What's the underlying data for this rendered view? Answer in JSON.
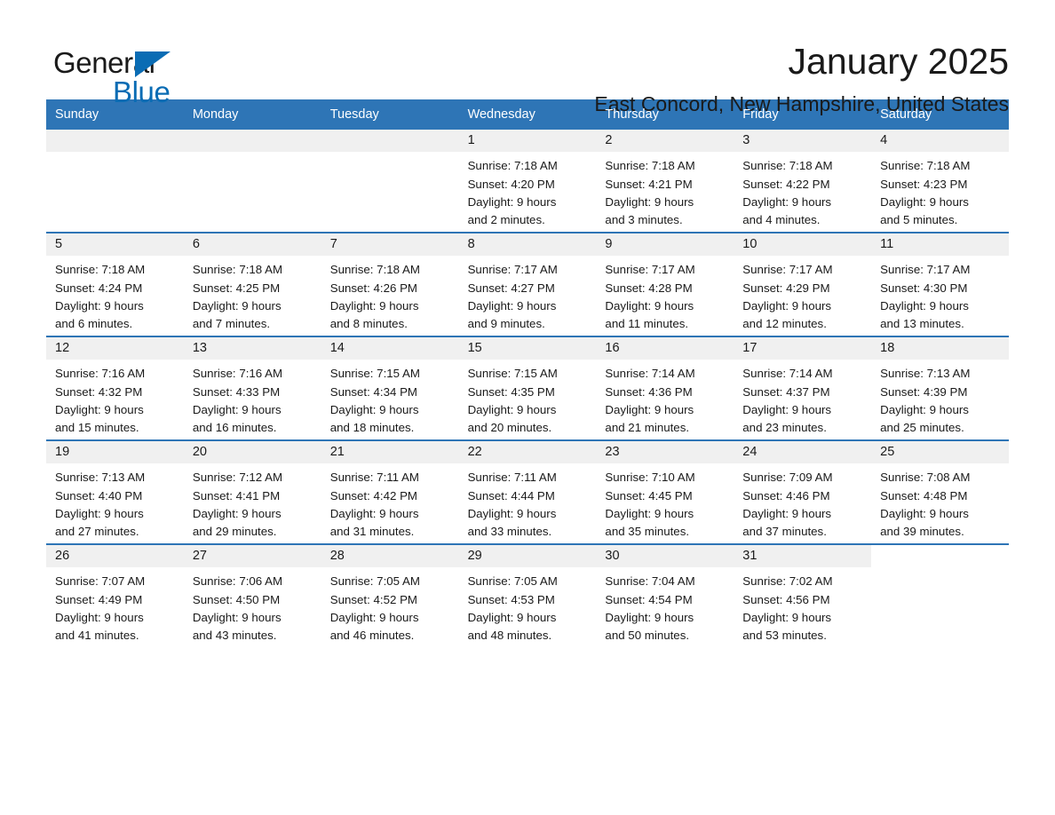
{
  "brand": {
    "name_part1": "General",
    "name_part2": "Blue",
    "triangle_color": "#0a6cb4"
  },
  "header": {
    "title": "January 2025",
    "subtitle": "East Concord, New Hampshire, United States"
  },
  "theme": {
    "header_blue": "#2e75b6",
    "daystrip_gray": "#f0f0f0",
    "text": "#1a1a1a"
  },
  "weekdays": [
    "Sunday",
    "Monday",
    "Tuesday",
    "Wednesday",
    "Thursday",
    "Friday",
    "Saturday"
  ],
  "weeks": [
    [
      {
        "day": "",
        "lines": []
      },
      {
        "day": "",
        "lines": []
      },
      {
        "day": "",
        "lines": []
      },
      {
        "day": "1",
        "lines": [
          "Sunrise: 7:18 AM",
          "Sunset: 4:20 PM",
          "Daylight: 9 hours",
          "and 2 minutes."
        ]
      },
      {
        "day": "2",
        "lines": [
          "Sunrise: 7:18 AM",
          "Sunset: 4:21 PM",
          "Daylight: 9 hours",
          "and 3 minutes."
        ]
      },
      {
        "day": "3",
        "lines": [
          "Sunrise: 7:18 AM",
          "Sunset: 4:22 PM",
          "Daylight: 9 hours",
          "and 4 minutes."
        ]
      },
      {
        "day": "4",
        "lines": [
          "Sunrise: 7:18 AM",
          "Sunset: 4:23 PM",
          "Daylight: 9 hours",
          "and 5 minutes."
        ]
      }
    ],
    [
      {
        "day": "5",
        "lines": [
          "Sunrise: 7:18 AM",
          "Sunset: 4:24 PM",
          "Daylight: 9 hours",
          "and 6 minutes."
        ]
      },
      {
        "day": "6",
        "lines": [
          "Sunrise: 7:18 AM",
          "Sunset: 4:25 PM",
          "Daylight: 9 hours",
          "and 7 minutes."
        ]
      },
      {
        "day": "7",
        "lines": [
          "Sunrise: 7:18 AM",
          "Sunset: 4:26 PM",
          "Daylight: 9 hours",
          "and 8 minutes."
        ]
      },
      {
        "day": "8",
        "lines": [
          "Sunrise: 7:17 AM",
          "Sunset: 4:27 PM",
          "Daylight: 9 hours",
          "and 9 minutes."
        ]
      },
      {
        "day": "9",
        "lines": [
          "Sunrise: 7:17 AM",
          "Sunset: 4:28 PM",
          "Daylight: 9 hours",
          "and 11 minutes."
        ]
      },
      {
        "day": "10",
        "lines": [
          "Sunrise: 7:17 AM",
          "Sunset: 4:29 PM",
          "Daylight: 9 hours",
          "and 12 minutes."
        ]
      },
      {
        "day": "11",
        "lines": [
          "Sunrise: 7:17 AM",
          "Sunset: 4:30 PM",
          "Daylight: 9 hours",
          "and 13 minutes."
        ]
      }
    ],
    [
      {
        "day": "12",
        "lines": [
          "Sunrise: 7:16 AM",
          "Sunset: 4:32 PM",
          "Daylight: 9 hours",
          "and 15 minutes."
        ]
      },
      {
        "day": "13",
        "lines": [
          "Sunrise: 7:16 AM",
          "Sunset: 4:33 PM",
          "Daylight: 9 hours",
          "and 16 minutes."
        ]
      },
      {
        "day": "14",
        "lines": [
          "Sunrise: 7:15 AM",
          "Sunset: 4:34 PM",
          "Daylight: 9 hours",
          "and 18 minutes."
        ]
      },
      {
        "day": "15",
        "lines": [
          "Sunrise: 7:15 AM",
          "Sunset: 4:35 PM",
          "Daylight: 9 hours",
          "and 20 minutes."
        ]
      },
      {
        "day": "16",
        "lines": [
          "Sunrise: 7:14 AM",
          "Sunset: 4:36 PM",
          "Daylight: 9 hours",
          "and 21 minutes."
        ]
      },
      {
        "day": "17",
        "lines": [
          "Sunrise: 7:14 AM",
          "Sunset: 4:37 PM",
          "Daylight: 9 hours",
          "and 23 minutes."
        ]
      },
      {
        "day": "18",
        "lines": [
          "Sunrise: 7:13 AM",
          "Sunset: 4:39 PM",
          "Daylight: 9 hours",
          "and 25 minutes."
        ]
      }
    ],
    [
      {
        "day": "19",
        "lines": [
          "Sunrise: 7:13 AM",
          "Sunset: 4:40 PM",
          "Daylight: 9 hours",
          "and 27 minutes."
        ]
      },
      {
        "day": "20",
        "lines": [
          "Sunrise: 7:12 AM",
          "Sunset: 4:41 PM",
          "Daylight: 9 hours",
          "and 29 minutes."
        ]
      },
      {
        "day": "21",
        "lines": [
          "Sunrise: 7:11 AM",
          "Sunset: 4:42 PM",
          "Daylight: 9 hours",
          "and 31 minutes."
        ]
      },
      {
        "day": "22",
        "lines": [
          "Sunrise: 7:11 AM",
          "Sunset: 4:44 PM",
          "Daylight: 9 hours",
          "and 33 minutes."
        ]
      },
      {
        "day": "23",
        "lines": [
          "Sunrise: 7:10 AM",
          "Sunset: 4:45 PM",
          "Daylight: 9 hours",
          "and 35 minutes."
        ]
      },
      {
        "day": "24",
        "lines": [
          "Sunrise: 7:09 AM",
          "Sunset: 4:46 PM",
          "Daylight: 9 hours",
          "and 37 minutes."
        ]
      },
      {
        "day": "25",
        "lines": [
          "Sunrise: 7:08 AM",
          "Sunset: 4:48 PM",
          "Daylight: 9 hours",
          "and 39 minutes."
        ]
      }
    ],
    [
      {
        "day": "26",
        "lines": [
          "Sunrise: 7:07 AM",
          "Sunset: 4:49 PM",
          "Daylight: 9 hours",
          "and 41 minutes."
        ]
      },
      {
        "day": "27",
        "lines": [
          "Sunrise: 7:06 AM",
          "Sunset: 4:50 PM",
          "Daylight: 9 hours",
          "and 43 minutes."
        ]
      },
      {
        "day": "28",
        "lines": [
          "Sunrise: 7:05 AM",
          "Sunset: 4:52 PM",
          "Daylight: 9 hours",
          "and 46 minutes."
        ]
      },
      {
        "day": "29",
        "lines": [
          "Sunrise: 7:05 AM",
          "Sunset: 4:53 PM",
          "Daylight: 9 hours",
          "and 48 minutes."
        ]
      },
      {
        "day": "30",
        "lines": [
          "Sunrise: 7:04 AM",
          "Sunset: 4:54 PM",
          "Daylight: 9 hours",
          "and 50 minutes."
        ]
      },
      {
        "day": "31",
        "lines": [
          "Sunrise: 7:02 AM",
          "Sunset: 4:56 PM",
          "Daylight: 9 hours",
          "and 53 minutes."
        ]
      },
      {
        "day": "",
        "lines": []
      }
    ]
  ]
}
